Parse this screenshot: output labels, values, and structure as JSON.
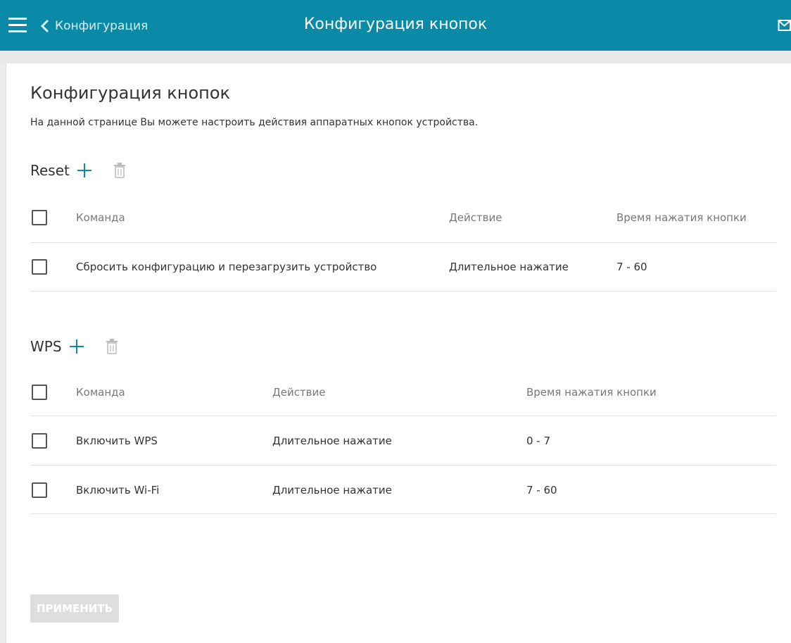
{
  "header": {
    "back_label": "Конфигурация",
    "title": "Конфигурация кнопок"
  },
  "page": {
    "title": "Конфигурация кнопок",
    "description": "На данной странице Вы можете настроить действия аппаратных кнопок устройства."
  },
  "reset": {
    "title": "Reset",
    "columns": [
      "Команда",
      "Действие",
      "Время нажатия кнопки"
    ],
    "rows": [
      {
        "command": "Сбросить конфигурацию и перезагрузить устройство",
        "action": "Длительное нажатие",
        "time": "7 - 60"
      }
    ]
  },
  "wps": {
    "title": "WPS",
    "columns": [
      "Команда",
      "Действие",
      "Время нажатия кнопки"
    ],
    "rows": [
      {
        "command": "Включить WPS",
        "action": "Длительное нажатие",
        "time": "0 - 7"
      },
      {
        "command": "Включить Wi-Fi",
        "action": "Длительное нажатие",
        "time": "7 - 60"
      }
    ]
  },
  "apply_label": "ПРИМЕНИТЬ",
  "icons": {
    "menu": "menu-icon",
    "back": "chevron-left-icon",
    "mail": "mail-icon",
    "add": "plus-icon",
    "delete": "trash-icon"
  },
  "colors": {
    "header_bg": "#0a8aa6",
    "accent": "#0a8aa6",
    "disabled_button": "#dedede"
  }
}
